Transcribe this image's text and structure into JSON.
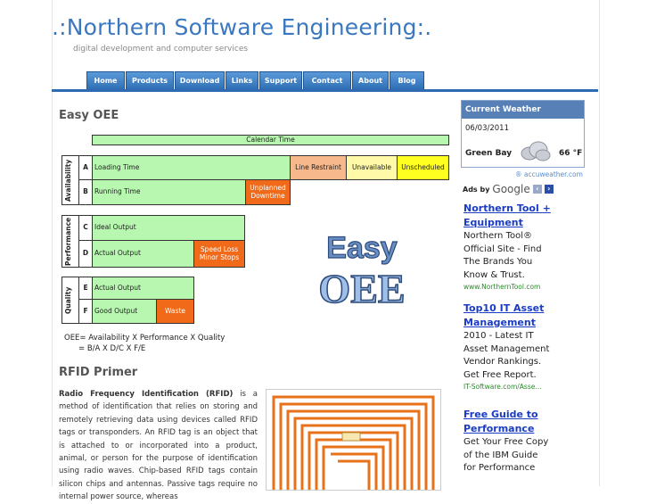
{
  "site": {
    "title": ".:Northern Software Engineering:.",
    "tagline": "digital development and computer services"
  },
  "nav": [
    "Home",
    "Products",
    "Download",
    "Links",
    "Support",
    "Contact",
    "About",
    "Blog"
  ],
  "main": {
    "heading": "Easy OEE",
    "diagram": {
      "calendar_time": "Calendar Time",
      "availability": "Availability",
      "performance": "Performance",
      "quality": "Quality",
      "letters": [
        "A",
        "B",
        "C",
        "D",
        "E",
        "F"
      ],
      "loading_time": "Loading Time",
      "line_restraint": "Line Restraint",
      "unavailable": "Unavailable",
      "unscheduled": "Unscheduled",
      "running_time": "Running Time",
      "unplanned_downtime": "Unplanned Downtime",
      "ideal_output": "Ideal Output",
      "actual_output": "Actual Output",
      "speed_loss": "Speed Loss Minor Stops",
      "actual_output_q": "Actual Output",
      "good_output": "Good Output",
      "waste": "Waste",
      "logo_word1": "Easy",
      "logo_word2": "OEE"
    },
    "formula_line1": "OEE= Availability X Performance X Quality",
    "formula_line2": "= B/A  X  D/C  X  F/E",
    "rfid_heading": "RFID Primer",
    "rfid_bold": "Radio Frequency Identification (RFID)",
    "rfid_text": " is a method of identification that relies on storing and remotely retrieving data using devices called RFID tags or transponders. An RFID tag is an object that is attached to or incorporated into a product, animal, or person for the purpose of identification using radio waves. Chip-based RFID tags contain silicon chips and antennas. Passive tags require no internal power source, whereas"
  },
  "weather": {
    "header": "Current Weather",
    "date": "06/03/2011",
    "city": "Green Bay",
    "temp": "66 °F",
    "credit": "® accuweather.com"
  },
  "ads": {
    "ads_by": "Ads by",
    "google": "Google",
    "items": [
      {
        "title": "Northern Tool + Equipment",
        "body": "Northern Tool® Official Site - Find The Brands You Know & Trust.",
        "url": "www.NorthernTool.com"
      },
      {
        "title": "Top10 IT Asset Management",
        "body": "2010 - Latest IT Asset Management Vendor Rankings. Get Free Report.",
        "url": "IT-Software.com/Asse..."
      },
      {
        "title": "Free Guide to Performance",
        "body": "Get Your Free Copy of the IBM Guide for Performance",
        "url": ""
      }
    ]
  },
  "colors": {
    "accent": "#2f6bb2",
    "title": "#3a78c0",
    "link": "#1a3cc4"
  }
}
